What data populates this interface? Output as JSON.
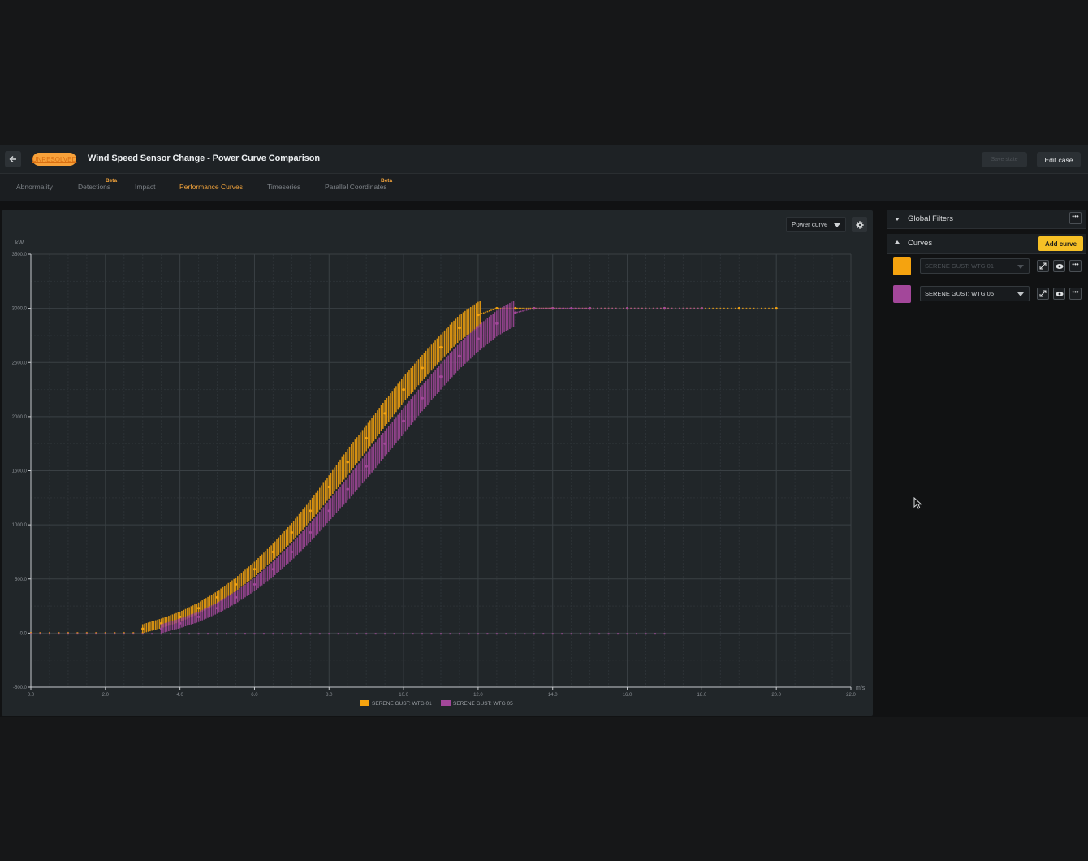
{
  "header": {
    "status_label": "UNRESOLVED",
    "case_title": "Wind Speed Sensor Change - Power Curve Comparison",
    "save_label": "Save state",
    "edit_label": "Edit case"
  },
  "tabs": [
    {
      "label": "Abnormality",
      "active": false
    },
    {
      "label": "Detections",
      "active": false,
      "badge": "Beta"
    },
    {
      "label": "Impact",
      "active": false
    },
    {
      "label": "Performance Curves",
      "active": true
    },
    {
      "label": "Timeseries",
      "active": false
    },
    {
      "label": "Parallel Coordinates",
      "active": false,
      "badge": "Beta"
    }
  ],
  "chart_controls": {
    "type_select": "Power curve",
    "settings_icon": "gear-icon"
  },
  "sidebar": {
    "global_filters_label": "Global Filters",
    "curves_label": "Curves",
    "add_curve_label": "Add curve",
    "curves": [
      {
        "label": "SERENE GUST: WTG 01",
        "color": "#f5a30f",
        "dimmed": true
      },
      {
        "label": "SERENE GUST: WTG 05",
        "color": "#a3479a",
        "dimmed": false
      }
    ]
  },
  "colors": {
    "accent": "#f2a33b",
    "series_1": "#f5a30f",
    "series_2": "#a3479a",
    "button_yellow": "#f6c026"
  },
  "chart_data": {
    "type": "scatter",
    "xlabel": "m/s",
    "ylabel": "kW",
    "xlim": [
      0,
      22
    ],
    "ylim": [
      -500,
      3500
    ],
    "x_ticks": [
      "0.0",
      "2.0",
      "4.0",
      "6.0",
      "8.0",
      "10.0",
      "12.0",
      "14.0",
      "16.0",
      "18.0",
      "20.0",
      "22.0"
    ],
    "y_ticks": [
      "-500.0",
      "0.0",
      "500.0",
      "1000.0",
      "1500.0",
      "2000.0",
      "2500.0",
      "3000.0",
      "3500.0"
    ],
    "grid": true,
    "legend_position": "bottom-center",
    "series": [
      {
        "name": "SERENE GUST: WTG 01",
        "color": "#f5a30f",
        "x": [
          3.0,
          3.5,
          4.0,
          4.5,
          5.0,
          5.5,
          6.0,
          6.5,
          7.0,
          7.5,
          8.0,
          8.5,
          9.0,
          9.5,
          10.0,
          10.5,
          11.0,
          11.5,
          12.0,
          12.5,
          13.0,
          13.5,
          14.0,
          15.0,
          16.0,
          17.0,
          18.0,
          19.0,
          20.0
        ],
        "y": [
          40,
          90,
          150,
          230,
          330,
          450,
          590,
          750,
          930,
          1130,
          1350,
          1580,
          1800,
          2030,
          2250,
          2450,
          2640,
          2820,
          2940,
          3000,
          3000,
          3000,
          3000,
          3000,
          3000,
          3000,
          3000,
          3000,
          3000
        ]
      },
      {
        "name": "SERENE GUST: WTG 05",
        "color": "#a3479a",
        "x": [
          3.5,
          4.0,
          4.5,
          5.0,
          5.5,
          6.0,
          6.5,
          7.0,
          7.5,
          8.0,
          8.5,
          9.0,
          9.5,
          10.0,
          10.5,
          11.0,
          11.5,
          12.0,
          12.5,
          13.0,
          13.5,
          14.0,
          14.5,
          15.0,
          16.0,
          17.0,
          18.0
        ],
        "y": [
          40,
          90,
          150,
          230,
          330,
          450,
          590,
          750,
          930,
          1130,
          1330,
          1540,
          1750,
          1960,
          2170,
          2370,
          2560,
          2720,
          2860,
          2960,
          3000,
          3000,
          3000,
          3000,
          3000,
          3000,
          3000
        ]
      }
    ]
  }
}
